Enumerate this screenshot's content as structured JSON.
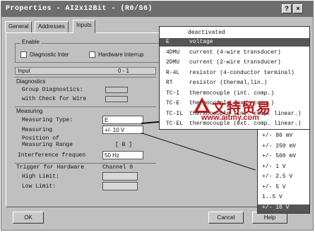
{
  "window": {
    "title": "Properties - AI2x12Bit - (R0/S6)",
    "help_btn": "?",
    "close_btn": "×"
  },
  "tabs": [
    "General",
    "Addresses",
    "Inputs"
  ],
  "enable": {
    "group_label": "Enable",
    "diagnostic_interrupt": "Diagnostic Inter",
    "hardware_interrupt": "Hardware Interrup"
  },
  "input_header": {
    "label": "Input",
    "channels": "0 - 1"
  },
  "diagnostics": {
    "label": "Diagnostics",
    "group_diagnostics": "Group Diagnostics:",
    "check_for_wire": "with Check for Wire"
  },
  "measuring": {
    "label": "Measuring",
    "type_label": "Measuring Type:",
    "type_value": "E",
    "range_label": "Measuring",
    "range_value": "+/- 10 V",
    "position_label_1": "Position of",
    "position_label_2": "Measuring Range",
    "position_value": "[ B ]",
    "interference_label": "Interference frequen",
    "interference_value": "50 Hz"
  },
  "trigger": {
    "label": "Trigger for Hardware",
    "channel": "Channel 0",
    "high_limit": "High Limit:",
    "low_limit": "Low Limit:"
  },
  "buttons": {
    "ok": "OK",
    "cancel": "Cancel",
    "help": "Help"
  },
  "type_dropdown": {
    "header": "deactivated",
    "items": [
      {
        "code": "E",
        "desc": "voltage",
        "selected": true
      },
      {
        "code": "4DMU",
        "desc": "current (4-wire transducer)",
        "selected": false
      },
      {
        "code": "2DMU",
        "desc": "current (2-wire transducer)",
        "selected": false
      },
      {
        "code": "R-4L",
        "desc": "resistor (4-conductor terminal)",
        "selected": false
      },
      {
        "code": "RT",
        "desc": "resistor (thermal,lin.)",
        "selected": false
      },
      {
        "code": "TC-I",
        "desc": "thermocouple (int. comp.)",
        "selected": false
      },
      {
        "code": "TC-E",
        "desc": "thermocouple (ext. comp.)",
        "selected": false
      },
      {
        "code": "TC-IL",
        "desc": "thermocouple (int. comp. linear.)",
        "selected": false
      },
      {
        "code": "TC-EL",
        "desc": "thermocouple (ext. comp. linear.)",
        "selected": false
      }
    ]
  },
  "range_dropdown": {
    "items": [
      {
        "label": "+/- 80 mV",
        "selected": false
      },
      {
        "label": "+/- 250 mV",
        "selected": false
      },
      {
        "label": "+/- 500 mV",
        "selected": false
      },
      {
        "label": "+/- 1 V",
        "selected": false
      },
      {
        "label": "+/- 2.5 V",
        "selected": false
      },
      {
        "label": "+/- 5 V",
        "selected": false
      },
      {
        "label": "1..5 V",
        "selected": false
      },
      {
        "label": "+/- 10 V",
        "selected": true
      }
    ]
  },
  "watermark": {
    "text": "文特贸易",
    "url": "www.aitmy.com"
  },
  "colors": {
    "titlebar": "#6d6d6d",
    "dialog": "#c0c0c0",
    "selection": "#555555",
    "watermark": "#b71c1c"
  }
}
